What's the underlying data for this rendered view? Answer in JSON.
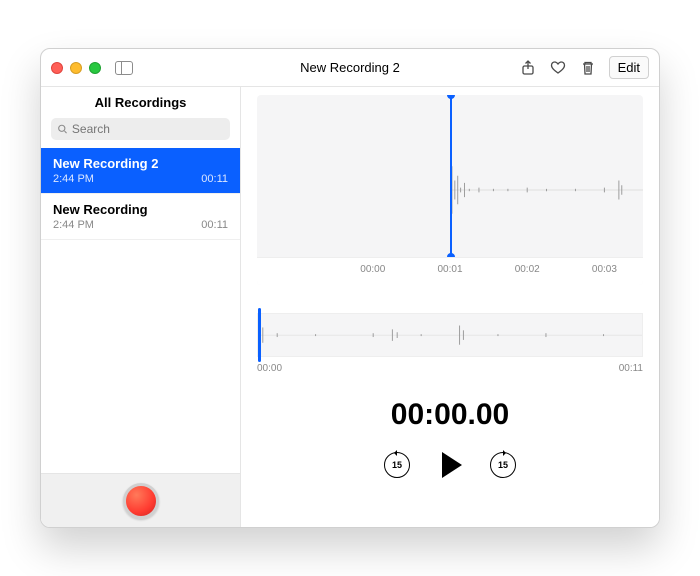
{
  "window": {
    "title": "New Recording 2"
  },
  "toolbar": {
    "edit_label": "Edit"
  },
  "sidebar": {
    "header": "All Recordings",
    "search_placeholder": "Search",
    "items": [
      {
        "title": "New Recording 2",
        "time": "2:44 PM",
        "duration": "00:11",
        "selected": true
      },
      {
        "title": "New Recording",
        "time": "2:44 PM",
        "duration": "00:11",
        "selected": false
      }
    ]
  },
  "zoom_ruler": [
    "00:00",
    "00:01",
    "00:02",
    "00:03"
  ],
  "full_labels": {
    "start": "00:00",
    "end": "00:11"
  },
  "playback_time": "00:00.00",
  "skip_seconds": "15"
}
